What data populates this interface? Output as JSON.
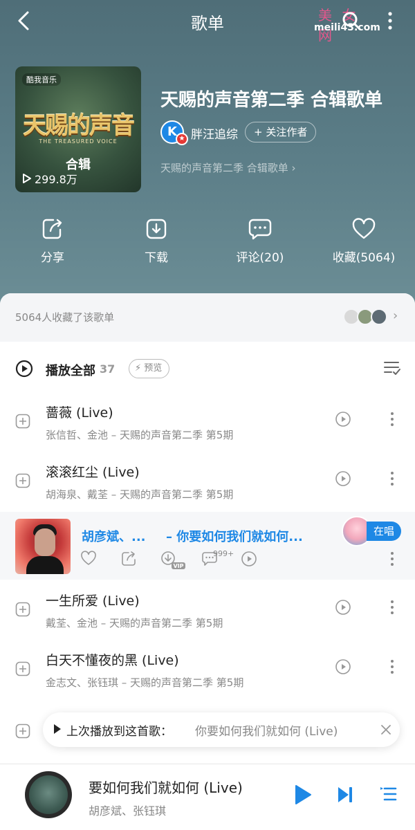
{
  "header": {
    "title": "歌单",
    "watermark_top": "美 女 网",
    "watermark_bottom": "meili43.com"
  },
  "cover": {
    "badge": "酷我音乐",
    "title": "天赐的声音",
    "subtitle": "THE TREASURED VOICE",
    "tag": "合辑",
    "plays": "299.8万"
  },
  "playlist": {
    "title": "天赐的声音第二季 合辑歌单",
    "author_avatar_letter": "K",
    "author_name": "胖汪追综",
    "follow_label": "+ 关注作者",
    "description": "天赐的声音第二季 合辑歌单 ›"
  },
  "actions": {
    "share": "分享",
    "download": "下载",
    "comment": "评论(20)",
    "collect": "收藏(5064)"
  },
  "collectors": {
    "text": "5064人收藏了该歌单"
  },
  "list_header": {
    "play_all": "播放全部",
    "count": "37",
    "preview": "预览"
  },
  "songs": [
    {
      "title": "蔷薇 (Live)",
      "meta": "张信哲、金池 – 天赐的声音第二季 第5期"
    },
    {
      "title": "滚滚红尘 (Live)",
      "meta": "胡海泉、戴荃 – 天赐的声音第二季 第5期"
    },
    {
      "title": "一生所爱 (Live)",
      "meta": "戴荃、金池 – 天赐的声音第二季 第5期"
    },
    {
      "title": "白天不懂夜的黑 (Live)",
      "meta": "金志文、张钰琪 – 天赐的声音第二季 第5期"
    }
  ],
  "now_playing_row": {
    "artists": "胡彦斌、...",
    "title": "– 你要如何我们就如何...",
    "live_label": "在唱",
    "comment_badge": "999+"
  },
  "toast": {
    "label": "上次播放到这首歌：",
    "song": "你要如何我们就如何 (Live)"
  },
  "player": {
    "title": "要如何我们就如何 (Live)",
    "artist": "胡彦斌、张钰琪"
  },
  "colors": {
    "accent": "#1e88e5",
    "hero": "#5a7c86",
    "watermark": "#e4578c"
  }
}
